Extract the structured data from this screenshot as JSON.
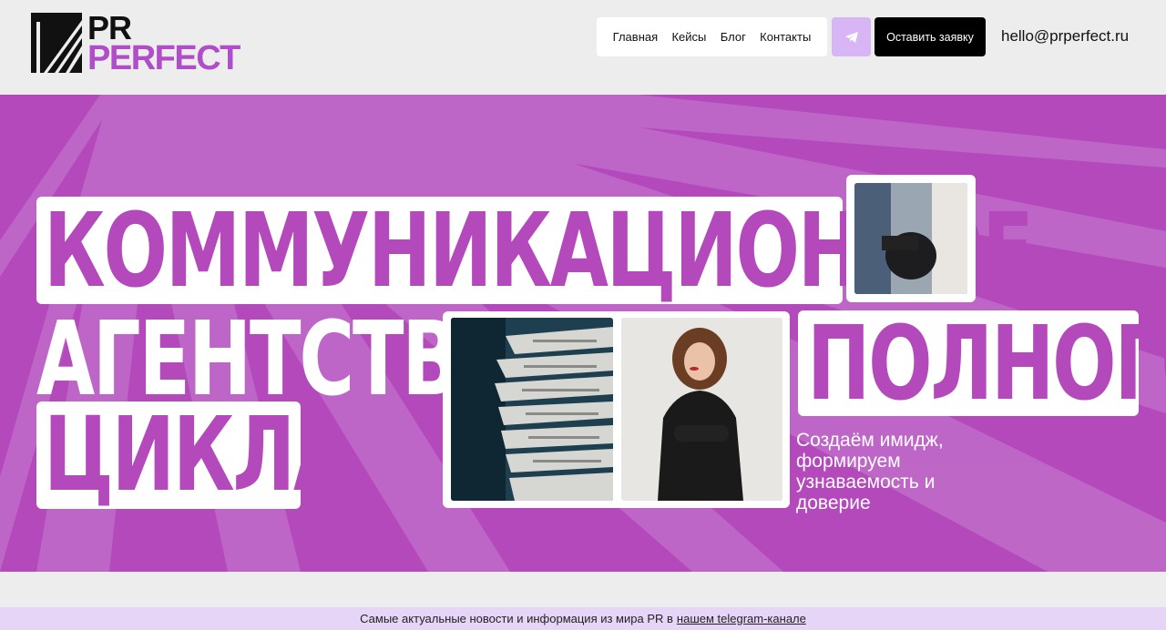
{
  "header": {
    "logo_line1": "PR",
    "logo_line2": "PERFECT",
    "nav": [
      "Главная",
      "Кейсы",
      "Блог",
      "Контакты"
    ],
    "cta_label": "Оставить заявку",
    "email": "hello@prperfect.ru",
    "telegram_icon": "telegram-icon"
  },
  "hero": {
    "word1": "КОММУНИКАЦИОННОЕ",
    "word2": "АГЕНТСТВО",
    "word3": "ЦИКЛА",
    "word4": "ПОЛНОГО",
    "subtitle": "Создаём имидж, формируем узнаваемость и доверие"
  },
  "banner": {
    "text": "Самые актуальные новости и информация из мира PR в",
    "link": "нашем telegram-канале"
  },
  "colors": {
    "brand": "#b449bc",
    "accent_light": "#d8b6f5",
    "banner_bg": "#e6d5f7"
  }
}
